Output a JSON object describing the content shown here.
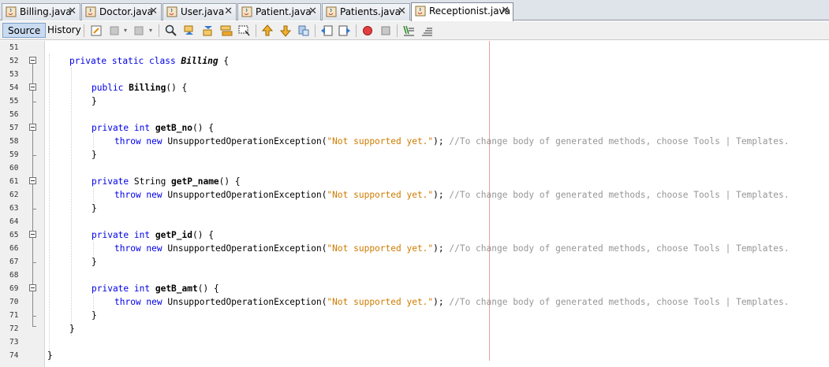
{
  "tabs": [
    {
      "label": "Billing.java",
      "active": false
    },
    {
      "label": "Doctor.java",
      "active": false
    },
    {
      "label": "User.java",
      "active": false
    },
    {
      "label": "Patient.java",
      "active": false
    },
    {
      "label": "Patients.java",
      "active": false
    },
    {
      "label": "Receptionist.java",
      "active": true
    }
  ],
  "toolbar": {
    "source_label": "Source",
    "history_label": "History",
    "icons": [
      "last-edit-icon",
      "back-icon",
      "forward-icon",
      "find-icon",
      "find-previous-icon",
      "find-next-icon",
      "toggle-highlight-icon",
      "find-selection-icon",
      "previous-bookmark-icon",
      "next-bookmark-icon",
      "toggle-bookmark-icon",
      "shift-left-icon",
      "shift-right-icon",
      "start-macro-icon",
      "stop-macro-icon",
      "comment-icon",
      "uncomment-icon"
    ]
  },
  "close_glyph": "✕",
  "editor": {
    "line_numbers": [
      "51",
      "52",
      "53",
      "54",
      "55",
      "56",
      "57",
      "58",
      "59",
      "60",
      "61",
      "62",
      "63",
      "64",
      "65",
      "66",
      "67",
      "68",
      "69",
      "70",
      "71",
      "72",
      "73",
      "74"
    ],
    "lines": {
      "l52": {
        "kw1": "private static class",
        "name": "Billing",
        "rest": " {"
      },
      "l54": {
        "kw": "public",
        "name": "Billing",
        "rest": "() {"
      },
      "l55": {
        "text": "}"
      },
      "l57": {
        "kw": "private int",
        "name": "getB_no",
        "rest": "() {"
      },
      "l58": {
        "kw": "throw new",
        "cls": " UnsupportedOperationException(",
        "str": "\"Not supported yet.\"",
        "end": "); ",
        "comment": "//To change body of generated methods, choose Tools | Templates."
      },
      "l59": {
        "text": "}"
      },
      "l61": {
        "kw": "private",
        "type": " String ",
        "name": "getP_name",
        "rest": "() {"
      },
      "l62": {
        "kw": "throw new",
        "cls": " UnsupportedOperationException(",
        "str": "\"Not supported yet.\"",
        "end": "); ",
        "comment": "//To change body of generated methods, choose Tools | Templates."
      },
      "l63": {
        "text": "}"
      },
      "l65": {
        "kw": "private int",
        "name": "getP_id",
        "rest": "() {"
      },
      "l66": {
        "kw": "throw new",
        "cls": " UnsupportedOperationException(",
        "str": "\"Not supported yet.\"",
        "end": "); ",
        "comment": "//To change body of generated methods, choose Tools | Templates."
      },
      "l67": {
        "text": "}"
      },
      "l69": {
        "kw": "private int",
        "name": "getB_amt",
        "rest": "() {"
      },
      "l70": {
        "kw": "throw new",
        "cls": " UnsupportedOperationException(",
        "str": "\"Not supported yet.\"",
        "end": "); ",
        "comment": "//To change body of generated methods, choose Tools | Templates."
      },
      "l71": {
        "text": "}"
      },
      "l72": {
        "text": "}"
      },
      "l74": {
        "text": "}"
      }
    }
  }
}
